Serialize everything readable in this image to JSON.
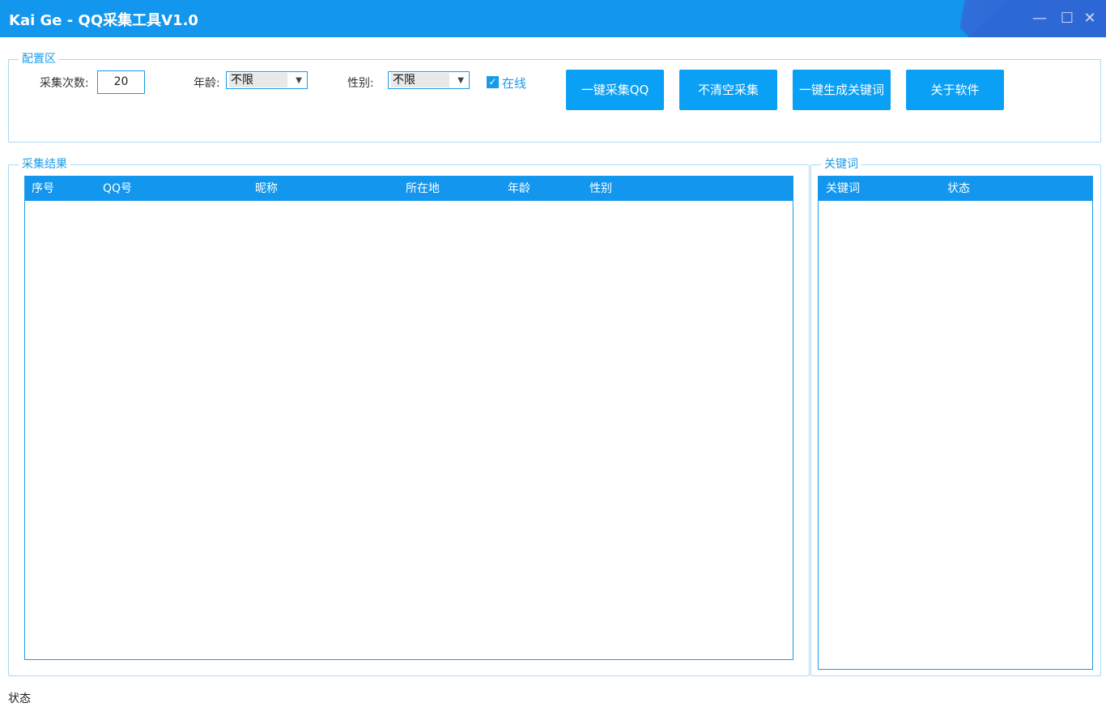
{
  "window": {
    "title": "Kai Ge - QQ采集工具V1.0",
    "minimize_glyph": "—",
    "maximize_glyph": "☐",
    "close_glyph": "✕"
  },
  "config": {
    "group_label": "配置区",
    "count_label": "采集次数:",
    "count_value": "20",
    "age_label": "年龄:",
    "age_value": "不限",
    "gender_label": "性别:",
    "gender_value": "不限",
    "online_label": "在线",
    "online_checked": true,
    "buttons": {
      "collect": "一键采集QQ",
      "no_clear": "不清空采集",
      "gen_keywords": "一键生成关键词",
      "about": "关于软件"
    }
  },
  "results": {
    "group_label": "采集结果",
    "columns": [
      "序号",
      "QQ号",
      "昵称",
      "所在地",
      "年龄",
      "性别"
    ],
    "rows": []
  },
  "keywords": {
    "group_label": "关键词",
    "columns": [
      "关键词",
      "状态"
    ],
    "rows": []
  },
  "statusbar": {
    "text": "状态"
  },
  "colors": {
    "titlebar": "#1296ee",
    "accent": "#1a9be8",
    "button": "#0aa0f5"
  }
}
